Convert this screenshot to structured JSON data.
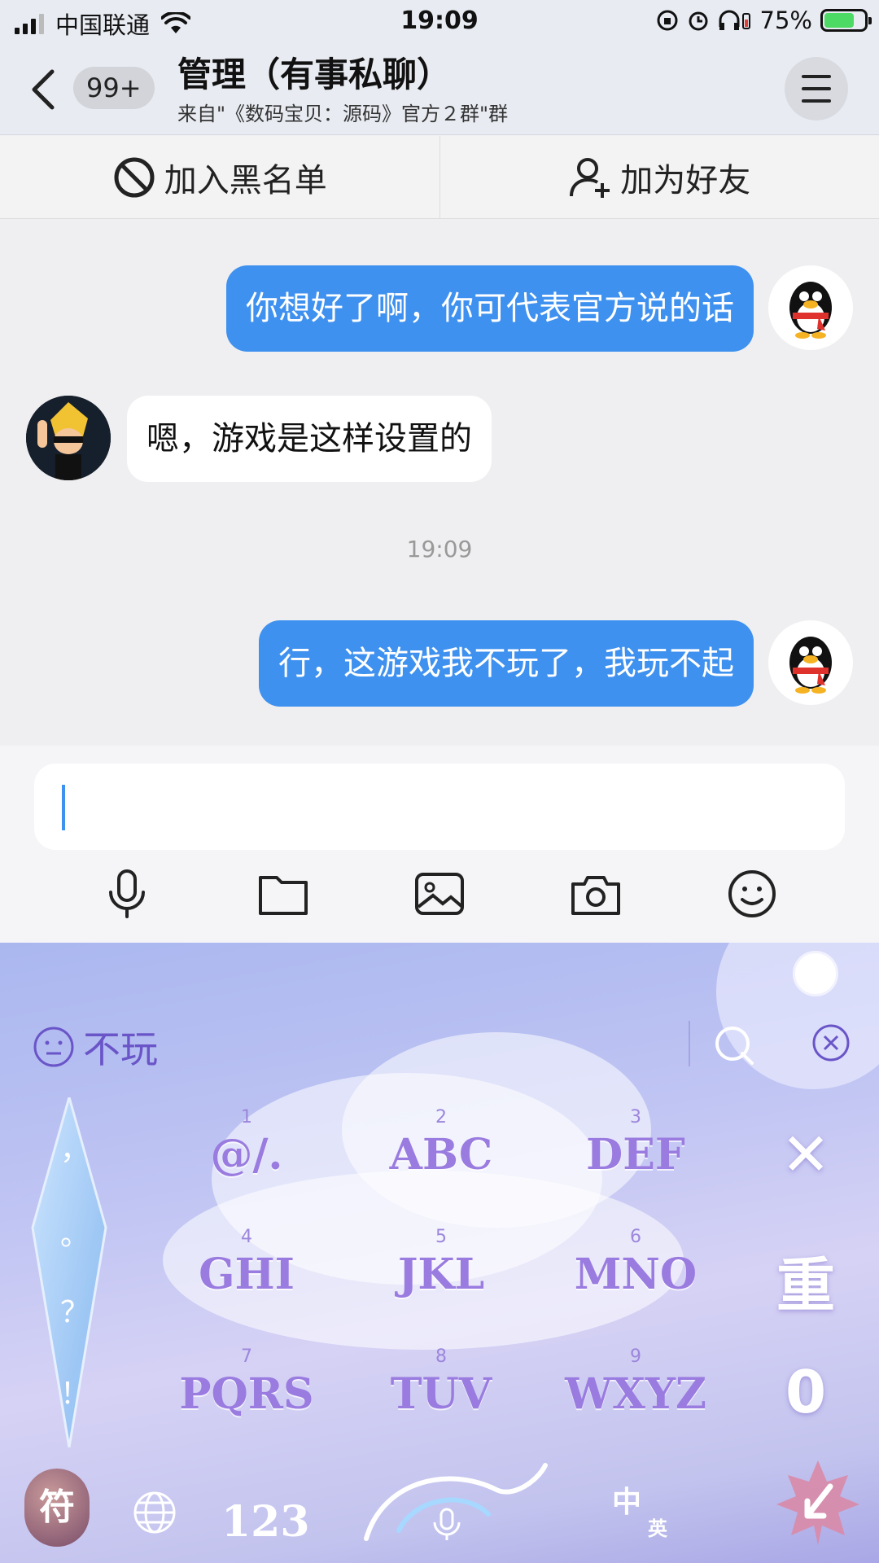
{
  "status_bar": {
    "carrier": "中国联通",
    "time": "19:09",
    "battery": "75%"
  },
  "header": {
    "badge": "99+",
    "title": "管理（有事私聊）",
    "subtitle": "来自\"《数码宝贝：源码》官方２群\"群"
  },
  "actions": {
    "block": "加入黑名单",
    "add_friend": "加为好友"
  },
  "messages": [
    {
      "from": "me",
      "text": "你想好了啊，你可代表官方说的话"
    },
    {
      "from": "them",
      "text": "嗯，游戏是这样设置的"
    },
    {
      "from": "me",
      "text": "行，这游戏我不玩了，我玩不起"
    }
  ],
  "timestamp": "19:09",
  "input": {
    "value": ""
  },
  "toolbar": [
    "microphone-icon",
    "folder-icon",
    "image-icon",
    "camera-icon",
    "emoji-icon"
  ],
  "keyboard": {
    "candidate": "不玩",
    "keys": [
      {
        "num": "1",
        "label": "@/."
      },
      {
        "num": "2",
        "label": "ABC"
      },
      {
        "num": "3",
        "label": "DEF"
      },
      {
        "num": "4",
        "label": "GHI"
      },
      {
        "num": "5",
        "label": "JKL"
      },
      {
        "num": "6",
        "label": "MNO"
      },
      {
        "num": "7",
        "label": "PQRS"
      },
      {
        "num": "8",
        "label": "TUV"
      },
      {
        "num": "9",
        "label": "WXYZ"
      }
    ],
    "punctuation": [
      "，",
      "。",
      "？",
      "！"
    ],
    "side_keys": {
      "delete": "✕",
      "retype": "重",
      "zero": "0"
    },
    "bottom": {
      "symbol": "符",
      "numbers": "123",
      "lang_zh": "中",
      "lang_en": "英"
    }
  },
  "colors": {
    "bubble_me": "#3f91ef",
    "bubble_them": "#ffffff",
    "key_text": "#9a7be0"
  }
}
